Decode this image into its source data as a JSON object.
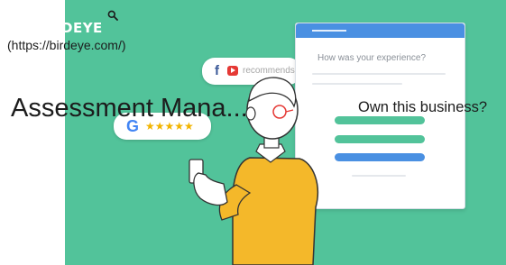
{
  "header": {
    "logo_text": "DEYE",
    "url_text": "(https://birdeye.com/)",
    "search_icon": "search-icon"
  },
  "main": {
    "title": "Assessment Mana...",
    "own_business_label": "Own this business?"
  },
  "illustration": {
    "recommend_text": "recommends",
    "fb_icon": "facebook-icon",
    "google_icon": "google-icon",
    "survey_question": "How was your experience?",
    "colors": {
      "background": "#52c39a",
      "survey_header": "#4a90e2",
      "person_shirt": "#f4b82a",
      "stars": "#f2b400"
    }
  }
}
